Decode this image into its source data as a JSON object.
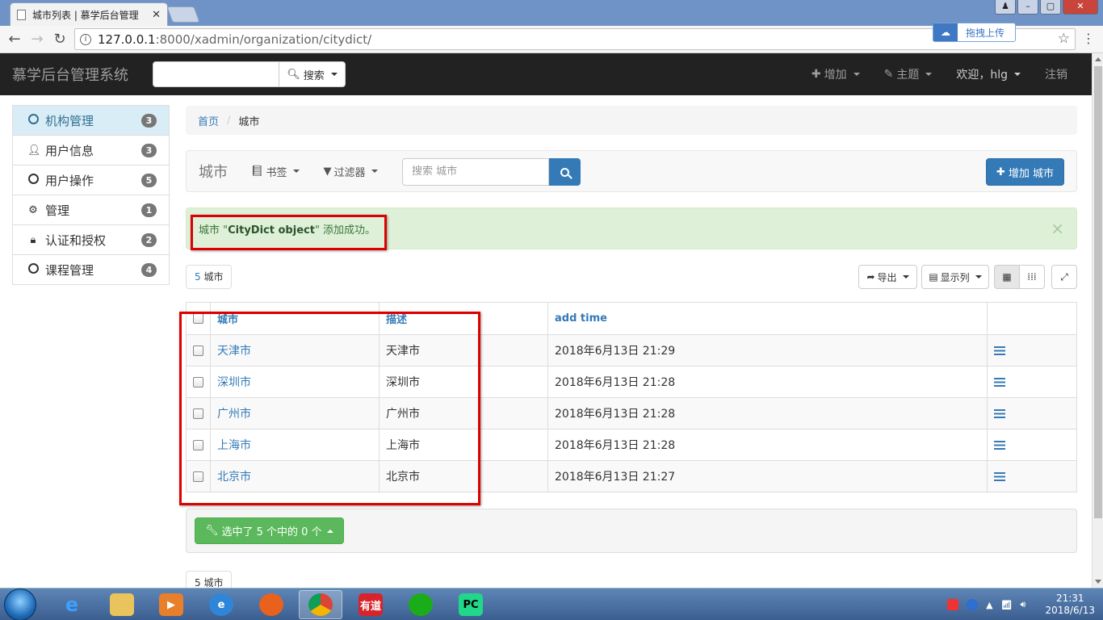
{
  "browser": {
    "tab_title": "城市列表 | 慕学后台管理",
    "url_host": "127.0.0.1",
    "url_path": ":8000/xadmin/organization/citydict/",
    "upload_label": "拖拽上传"
  },
  "navbar": {
    "brand": "慕学后台管理系统",
    "search_label": "搜索",
    "add_label": "增加",
    "theme_label": "主题",
    "welcome_label": "欢迎，hlg",
    "logout_label": "注销"
  },
  "sidebar": {
    "items": [
      {
        "label": "机构管理",
        "count": "3",
        "icon": "circle-icon"
      },
      {
        "label": "用户信息",
        "count": "3",
        "icon": "user-icon"
      },
      {
        "label": "用户操作",
        "count": "5",
        "icon": "circle-icon"
      },
      {
        "label": "管理",
        "count": "1",
        "icon": "gear-icon"
      },
      {
        "label": "认证和授权",
        "count": "2",
        "icon": "lock-icon"
      },
      {
        "label": "课程管理",
        "count": "4",
        "icon": "circle-icon"
      }
    ]
  },
  "breadcrumb": {
    "home": "首页",
    "sep": "/",
    "current": "城市"
  },
  "panel": {
    "title": "城市",
    "bookmarks_label": "书签",
    "filters_label": "过滤器",
    "search_placeholder": "搜索 城市",
    "add_button_label": "增加 城市"
  },
  "alert": {
    "prefix": "城市 \"",
    "object": "CityDict object",
    "suffix": "\" 添加成功。",
    "close": "×"
  },
  "tools": {
    "count_num": "5",
    "count_unit": " 城市",
    "export_label": "导出",
    "columns_label": "显示列"
  },
  "table": {
    "headers": [
      "城市",
      "描述",
      "add time"
    ],
    "rows": [
      {
        "city": "天津市",
        "desc": "天津市",
        "time": "2018年6月13日 21:29"
      },
      {
        "city": "深圳市",
        "desc": "深圳市",
        "time": "2018年6月13日 21:28"
      },
      {
        "city": "广州市",
        "desc": "广州市",
        "time": "2018年6月13日 21:28"
      },
      {
        "city": "上海市",
        "desc": "上海市",
        "time": "2018年6月13日 21:28"
      },
      {
        "city": "北京市",
        "desc": "北京市",
        "time": "2018年6月13日 21:27"
      }
    ]
  },
  "actions": {
    "selected_label": "选中了 5 个中的 0 个"
  },
  "footer": {
    "count_label": "5 城市"
  },
  "taskbar": {
    "time": "21:31",
    "date": "2018/6/13"
  },
  "colors": {
    "primary": "#337ab7",
    "success": "#5cb85c",
    "navbar": "#222222",
    "alert_bg": "#dff0d8",
    "highlight_box": "#dd0000"
  }
}
